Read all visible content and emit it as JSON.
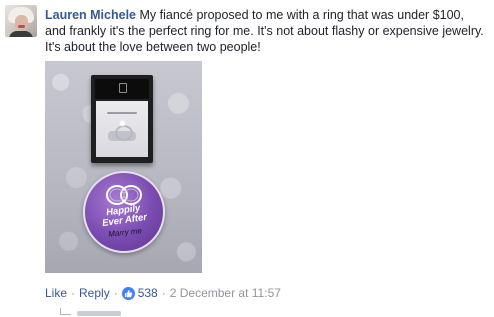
{
  "comment": {
    "author": "Lauren Michele",
    "text": "My fiancé proposed to me with a ring that was under $100, and frankly it's the perfect ring for me. It's not about flashy or expensive jewelry. It's about the love between two people!"
  },
  "photo": {
    "badge_line1": "Happily",
    "badge_line2": "Ever After",
    "badge_sign": "Marry me"
  },
  "actions": {
    "like": "Like",
    "reply": "Reply",
    "reaction_count": "538",
    "timestamp": "2 December at 11:57",
    "separator": "·"
  },
  "colors": {
    "link": "#365899",
    "meta": "#90949c",
    "like_icon": "#4080ff",
    "badge": "#7a4bb0"
  },
  "icons": [
    "avatar",
    "like-icon"
  ]
}
